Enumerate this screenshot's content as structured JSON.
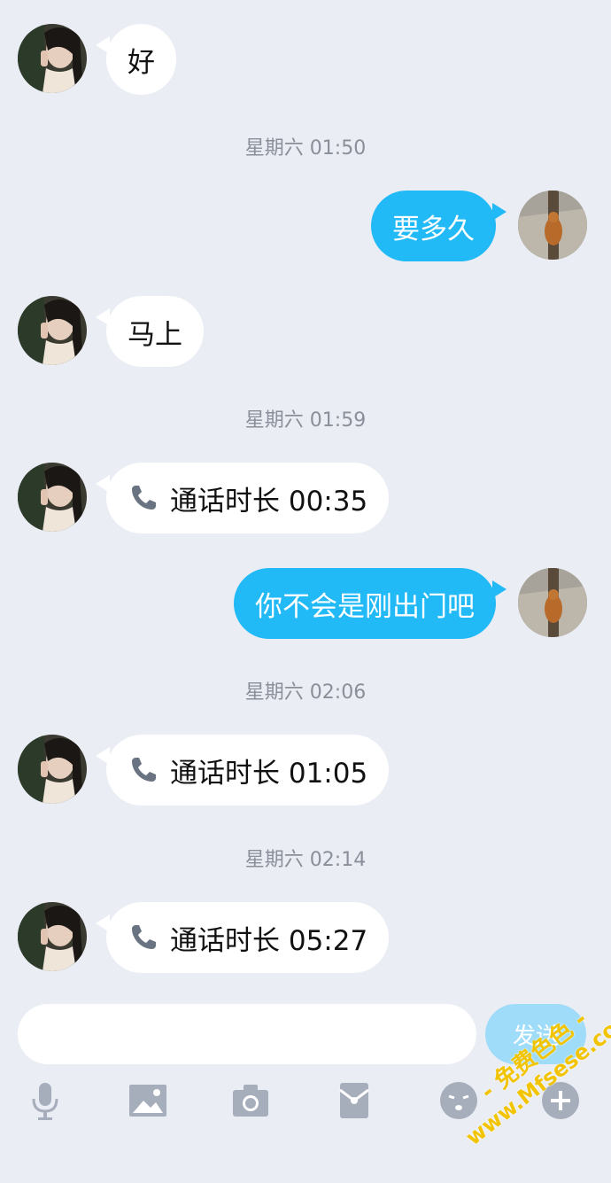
{
  "messages": [
    {
      "side": "in",
      "text": "好"
    },
    {
      "timestamp": "星期六 01:50"
    },
    {
      "side": "out",
      "text": "要多久"
    },
    {
      "side": "in",
      "text": "马上"
    },
    {
      "timestamp": "星期六 01:59"
    },
    {
      "side": "in",
      "type": "call",
      "text": "通话时长 00:35"
    },
    {
      "side": "out",
      "text": "你不会是刚出门吧"
    },
    {
      "timestamp": "星期六 02:06"
    },
    {
      "side": "in",
      "type": "call",
      "text": "通话时长 01:05"
    },
    {
      "timestamp": "星期六 02:14"
    },
    {
      "side": "in",
      "type": "call",
      "text": "通话时长 05:27"
    }
  ],
  "input": {
    "placeholder": "",
    "send_label": "发送"
  },
  "toolbar": {
    "icons": [
      "microphone-icon",
      "image-icon",
      "camera-icon",
      "red-packet-icon",
      "emoji-icon",
      "plus-icon"
    ]
  },
  "colors": {
    "background": "#eaedf4",
    "outgoing_bubble": "#21b9f6",
    "incoming_bubble": "#ffffff",
    "toolbar_icon": "#a6adbb",
    "send_button": "#9fdcfa"
  },
  "watermark": {
    "line1": "- 免费色色 -",
    "line2": "www.Mfsese.com"
  }
}
